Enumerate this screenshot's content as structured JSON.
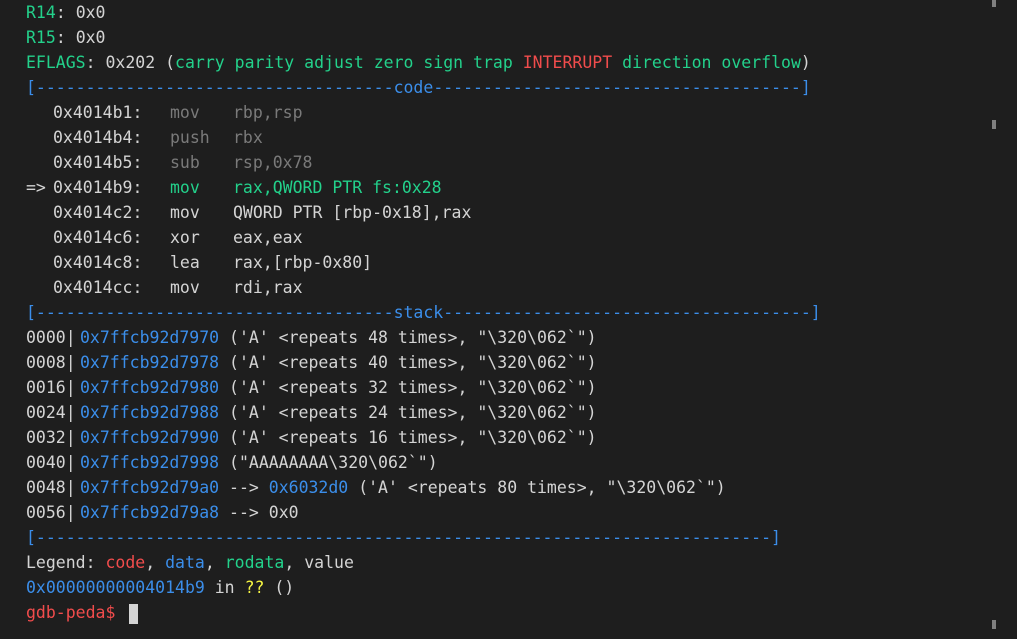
{
  "registers": [
    {
      "name": "R14",
      "sep": ": ",
      "value": "0x0"
    },
    {
      "name": "R15",
      "sep": ": ",
      "value": "0x0"
    }
  ],
  "eflags": {
    "name": "EFLAGS",
    "sep": ": ",
    "value": "0x202 (",
    "flags_a": "carry parity adjust zero sign trap",
    "flags_set": "INTERRUPT",
    "flags_b": "direction overflow",
    "close": ")"
  },
  "code_header": {
    "left": "[------------------------------------",
    "title": "code",
    "right": "-------------------------------------]"
  },
  "code": [
    {
      "arrow": "",
      "addr": "0x4014b1:",
      "mnemonic": "mov",
      "operands": "rbp,rsp",
      "state": "past"
    },
    {
      "arrow": "",
      "addr": "0x4014b4:",
      "mnemonic": "push",
      "operands": "rbx",
      "state": "past"
    },
    {
      "arrow": "",
      "addr": "0x4014b5:",
      "mnemonic": "sub",
      "operands": "rsp,0x78",
      "state": "past"
    },
    {
      "arrow": "=>",
      "addr": "0x4014b9:",
      "mnemonic": "mov",
      "operands": "rax,QWORD PTR fs:0x28",
      "state": "current"
    },
    {
      "arrow": "",
      "addr": "0x4014c2:",
      "mnemonic": "mov",
      "operands": "QWORD PTR [rbp-0x18],rax",
      "state": "next"
    },
    {
      "arrow": "",
      "addr": "0x4014c6:",
      "mnemonic": "xor",
      "operands": "eax,eax",
      "state": "next"
    },
    {
      "arrow": "",
      "addr": "0x4014c8:",
      "mnemonic": "lea",
      "operands": "rax,[rbp-0x80]",
      "state": "next"
    },
    {
      "arrow": "",
      "addr": "0x4014cc:",
      "mnemonic": "mov",
      "operands": "rdi,rax",
      "state": "next"
    }
  ],
  "stack_header": {
    "left": "[------------------------------------",
    "title": "stack",
    "right": "-------------------------------------]"
  },
  "stack": [
    {
      "offset": "0000|",
      "addr": "0x7ffcb92d7970",
      "arrow": "",
      "target": "",
      "value": "('A' <repeats 48 times>, \"\\320\\062`\")"
    },
    {
      "offset": "0008|",
      "addr": "0x7ffcb92d7978",
      "arrow": "",
      "target": "",
      "value": "('A' <repeats 40 times>, \"\\320\\062`\")"
    },
    {
      "offset": "0016|",
      "addr": "0x7ffcb92d7980",
      "arrow": "",
      "target": "",
      "value": "('A' <repeats 32 times>, \"\\320\\062`\")"
    },
    {
      "offset": "0024|",
      "addr": "0x7ffcb92d7988",
      "arrow": "",
      "target": "",
      "value": "('A' <repeats 24 times>, \"\\320\\062`\")"
    },
    {
      "offset": "0032|",
      "addr": "0x7ffcb92d7990",
      "arrow": "",
      "target": "",
      "value": "('A' <repeats 16 times>, \"\\320\\062`\")"
    },
    {
      "offset": "0040|",
      "addr": "0x7ffcb92d7998",
      "arrow": "",
      "target": "",
      "value": "(\"AAAAAAAA\\320\\062`\")"
    },
    {
      "offset": "0048|",
      "addr": "0x7ffcb92d79a0",
      "arrow": "-->",
      "target": "0x6032d0",
      "value": "('A' <repeats 80 times>, \"\\320\\062`\")"
    },
    {
      "offset": "0056|",
      "addr": "0x7ffcb92d79a8",
      "arrow": "-->",
      "target": "",
      "value": "0x0"
    }
  ],
  "footer_rule": "[--------------------------------------------------------------------------]",
  "legend": {
    "label": "Legend: ",
    "code": "code",
    "sep1": ", ",
    "data": "data",
    "sep2": ", ",
    "rodata": "rodata",
    "sep3": ", ",
    "value": "value"
  },
  "location": {
    "addr": "0x00000000004014b9",
    "in": " in ",
    "func": "??",
    "args": " ()"
  },
  "prompt": "gdb-peda$ ",
  "colors": {
    "background": "#1e1e1e",
    "register_name": "#23d18b",
    "code_color": "#f14c4c",
    "data_color": "#3b8eea",
    "rodata_color": "#23d18b",
    "current_instruction": "#23d18b",
    "past_instruction": "#7a7a7a"
  }
}
